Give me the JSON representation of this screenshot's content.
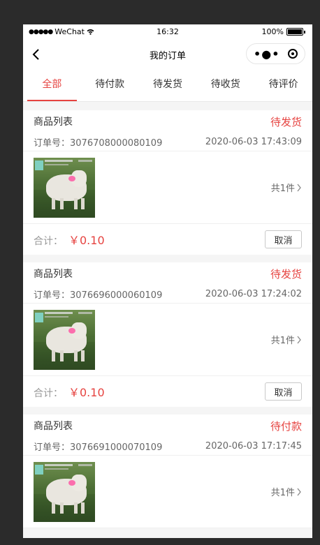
{
  "status_bar": {
    "carrier": "WeChat",
    "time": "16:32",
    "battery": "100%"
  },
  "nav": {
    "title": "我的订单"
  },
  "tabs": [
    {
      "label": "全部",
      "active": true
    },
    {
      "label": "待付款",
      "active": false
    },
    {
      "label": "待发货",
      "active": false
    },
    {
      "label": "待收货",
      "active": false
    },
    {
      "label": "待评价",
      "active": false
    }
  ],
  "orders": [
    {
      "title": "商品列表",
      "status": "待发货",
      "order_no": "订单号：3076708000080109",
      "datetime": "2020-06-03 17:43:09",
      "count": "共1件",
      "total_label": "合计：",
      "price": "￥0.10",
      "cancel": "取消"
    },
    {
      "title": "商品列表",
      "status": "待发货",
      "order_no": "订单号：3076696000060109",
      "datetime": "2020-06-03 17:24:02",
      "count": "共1件",
      "total_label": "合计：",
      "price": "￥0.10",
      "cancel": "取消"
    },
    {
      "title": "商品列表",
      "status": "待付款",
      "order_no": "订单号：3076691000070109",
      "datetime": "2020-06-03 17:17:45",
      "count": "共1件"
    }
  ],
  "colors": {
    "accent": "#e64340"
  }
}
